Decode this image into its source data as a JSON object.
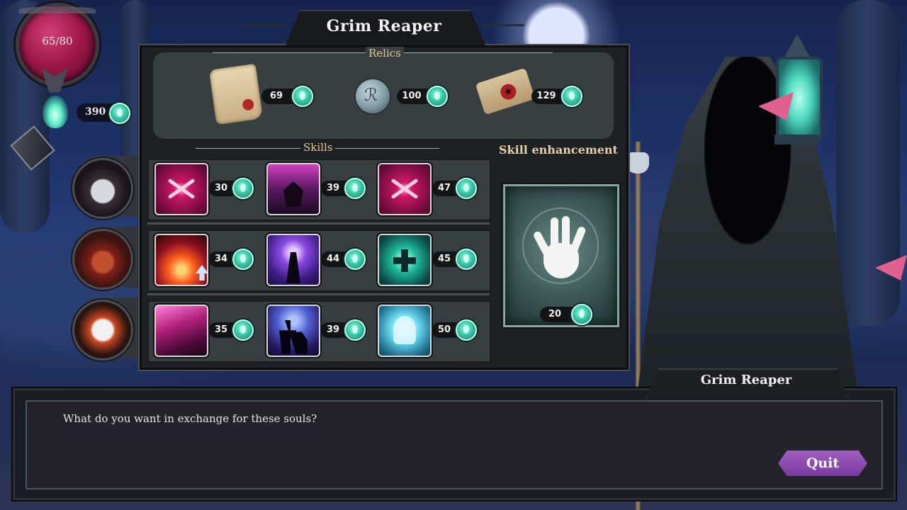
{
  "hud": {
    "health": "65/80",
    "souls": "390"
  },
  "shop": {
    "title": "Grim Reaper",
    "relics_label": "Relics",
    "skills_label": "Skills",
    "enhancement_label": "Skill enhancement",
    "relics": [
      {
        "icon": "scroll-icon",
        "price": "69"
      },
      {
        "icon": "medallion-icon",
        "price": "100"
      },
      {
        "icon": "sealed-letter-icon",
        "price": "129"
      }
    ],
    "skills": [
      [
        {
          "icon": "crimson-slash-icon",
          "price": "30"
        },
        {
          "icon": "shadow-demon-icon",
          "price": "39"
        },
        {
          "icon": "crimson-slash-icon",
          "price": "47"
        }
      ],
      [
        {
          "icon": "fire-burst-icon",
          "price": "34"
        },
        {
          "icon": "void-pillar-icon",
          "price": "44"
        },
        {
          "icon": "teal-cross-icon",
          "price": "45"
        }
      ],
      [
        {
          "icon": "pink-wave-icon",
          "price": "35"
        },
        {
          "icon": "spirit-figures-icon",
          "price": "39"
        },
        {
          "icon": "ghost-skull-icon",
          "price": "50"
        }
      ]
    ],
    "enhancement": {
      "icon": "spiral-hand-icon",
      "price": "20"
    }
  },
  "dialog": {
    "speaker": "Grim Reaper",
    "text": "What do you want in exchange for these souls?",
    "quit_label": "Quit"
  },
  "colors": {
    "soul_currency": "#38c9a8",
    "health": "#a01848",
    "quit_button": "#8a4ab0",
    "section_label": "#e2c79a"
  }
}
